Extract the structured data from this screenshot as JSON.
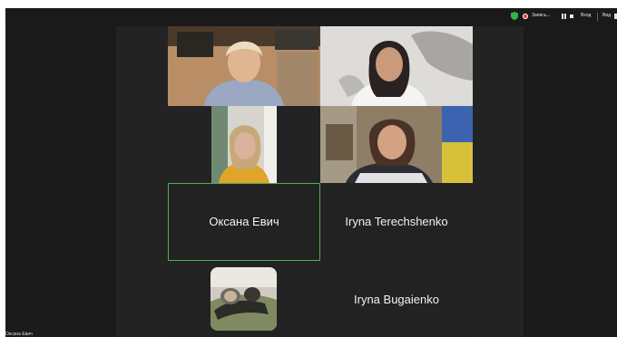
{
  "toolbar": {
    "recording_label": "Запись...",
    "signin_label": "Вход",
    "view_label": "Вид"
  },
  "participants": [
    {
      "name": "Оксана Евич",
      "active_speaker": true,
      "video": false
    },
    {
      "name": "Iryna Terechshenko",
      "video": false
    },
    {
      "name": "Iryna Bugaienko",
      "video": false
    }
  ],
  "self_view": {
    "name": "Оксана Евич"
  },
  "colors": {
    "background": "#1b1b1b",
    "tile_background": "#222222",
    "active_speaker_border": "#4fae55",
    "shield": "#2fb34a",
    "record": "#e23a3a"
  }
}
